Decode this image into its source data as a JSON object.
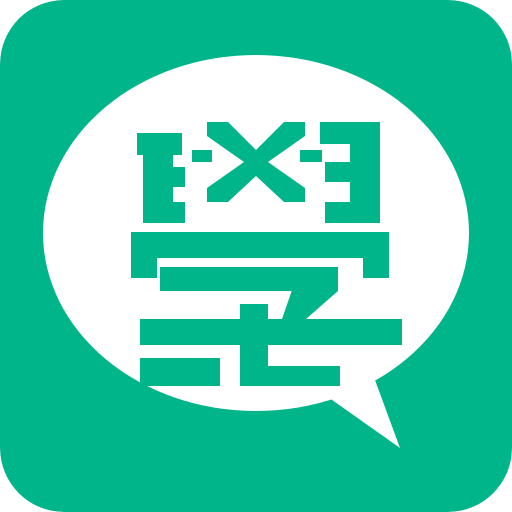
{
  "app_icon": {
    "name": "chat-bubble-glyph-app-icon",
    "glyph_text": "學",
    "colors": {
      "background": "#00B58A",
      "bubble": "#FFFFFF",
      "glyph": "#00B58A"
    }
  }
}
